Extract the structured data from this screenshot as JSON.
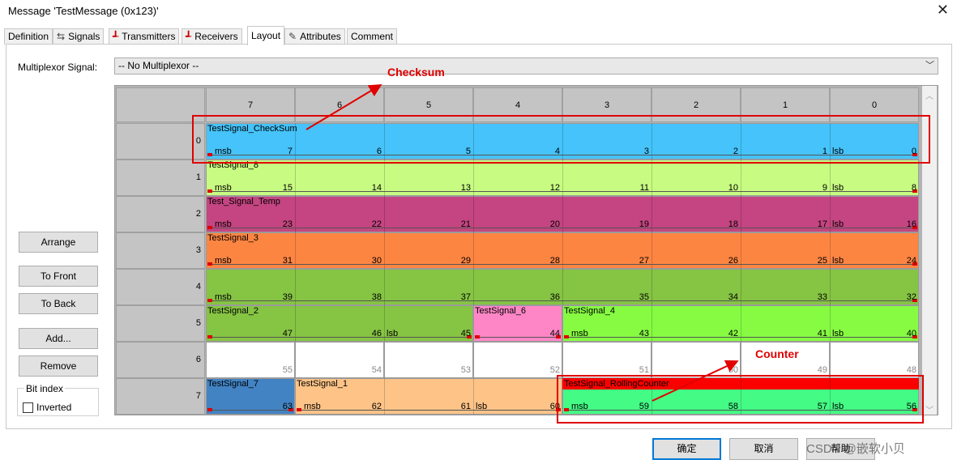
{
  "window": {
    "title": "Message 'TestMessage (0x123)'",
    "close_glyph": "✕"
  },
  "tabs": [
    {
      "label": "Definition",
      "icon": "",
      "active": false
    },
    {
      "label": "Signals",
      "icon": "signals-icon",
      "active": false
    },
    {
      "label": "Transmitters",
      "icon": "transmitter-icon",
      "active": false
    },
    {
      "label": "Receivers",
      "icon": "receiver-icon",
      "active": false
    },
    {
      "label": "Layout",
      "icon": "",
      "active": true
    },
    {
      "label": "Attributes",
      "icon": "attributes-icon",
      "active": false
    },
    {
      "label": "Comment",
      "icon": "",
      "active": false
    }
  ],
  "multiplexor": {
    "label": "Multiplexor Signal:",
    "value": "-- No Multiplexor --"
  },
  "grid": {
    "columns": [
      "7",
      "6",
      "5",
      "4",
      "3",
      "2",
      "1",
      "0"
    ],
    "rows": [
      "0",
      "1",
      "2",
      "3",
      "4",
      "5",
      "6",
      "7"
    ],
    "bit_numbers": [
      [
        "7",
        "6",
        "5",
        "4",
        "3",
        "2",
        "1",
        "0"
      ],
      [
        "15",
        "14",
        "13",
        "12",
        "11",
        "10",
        "9",
        "8"
      ],
      [
        "23",
        "22",
        "21",
        "20",
        "19",
        "18",
        "17",
        "16"
      ],
      [
        "31",
        "30",
        "29",
        "28",
        "27",
        "26",
        "25",
        "24"
      ],
      [
        "39",
        "38",
        "37",
        "36",
        "35",
        "34",
        "33",
        "32"
      ],
      [
        "47",
        "46",
        "45",
        "44",
        "43",
        "42",
        "41",
        "40"
      ],
      [
        "55",
        "54",
        "53",
        "52",
        "51",
        "50",
        "49",
        "48"
      ],
      [
        "63",
        "62",
        "61",
        "60",
        "59",
        "58",
        "57",
        "56"
      ]
    ],
    "signals": [
      {
        "name": "TestSignal_CheckSum",
        "row": 0,
        "start": 0,
        "end": 7,
        "color": "#45c3fa",
        "msb": "msb",
        "lsb": "lsb"
      },
      {
        "name": "TestSignal_8",
        "row": 1,
        "start": 0,
        "end": 7,
        "color": "#c8fb82",
        "msb": "msb",
        "lsb": "lsb"
      },
      {
        "name": "Test_Signal_Temp",
        "row": 2,
        "start": 0,
        "end": 7,
        "color": "#c44581",
        "msb": "msb",
        "lsb": "lsb"
      },
      {
        "name": "TestSignal_3",
        "row": 3,
        "start": 0,
        "end": 7,
        "color": "#fd8542",
        "msb": "msb",
        "lsb": "lsb"
      },
      {
        "name": "",
        "row": 4,
        "start": 0,
        "end": 7,
        "color": "#86c444",
        "msb": "msb",
        "lsb": ""
      },
      {
        "name": "TestSignal_2",
        "row": 5,
        "start": 0,
        "end": 2,
        "color": "#86c444",
        "msb": "",
        "lsb": "lsb"
      },
      {
        "name": "TestSignal_6",
        "row": 5,
        "start": 3,
        "end": 3,
        "color": "#fe86c6",
        "msb": "",
        "lsb": ""
      },
      {
        "name": "TestSignal_4",
        "row": 5,
        "start": 4,
        "end": 7,
        "color": "#86fb42",
        "msb": "msb",
        "lsb": "lsb"
      },
      {
        "name": "TestSignal_7",
        "row": 7,
        "start": 0,
        "end": 0,
        "color": "#4283c4",
        "msb": "",
        "lsb": ""
      },
      {
        "name": "TestSignal_1",
        "row": 7,
        "start": 1,
        "end": 3,
        "color": "#fdc387",
        "msb": "msb",
        "lsb": "lsb"
      },
      {
        "name": "TestSignal_RollingCounter",
        "row": 7,
        "start": 4,
        "end": 7,
        "color": "#43fb85",
        "band": "#fb0000",
        "msb": "msb",
        "lsb": "lsb"
      }
    ]
  },
  "buttons": {
    "arrange": "Arrange",
    "to_front": "To Front",
    "to_back": "To Back",
    "add": "Add...",
    "remove": "Remove"
  },
  "bit_index": {
    "label": "Bit index",
    "inverted_label": "Inverted",
    "inverted": false
  },
  "dialog_buttons": {
    "ok": "确定",
    "cancel": "取消",
    "help": "帮助"
  },
  "annotations": {
    "checksum": "Checksum",
    "counter": "Counter",
    "color": "#e00000"
  },
  "watermark": "CSDN @嵌软小贝"
}
